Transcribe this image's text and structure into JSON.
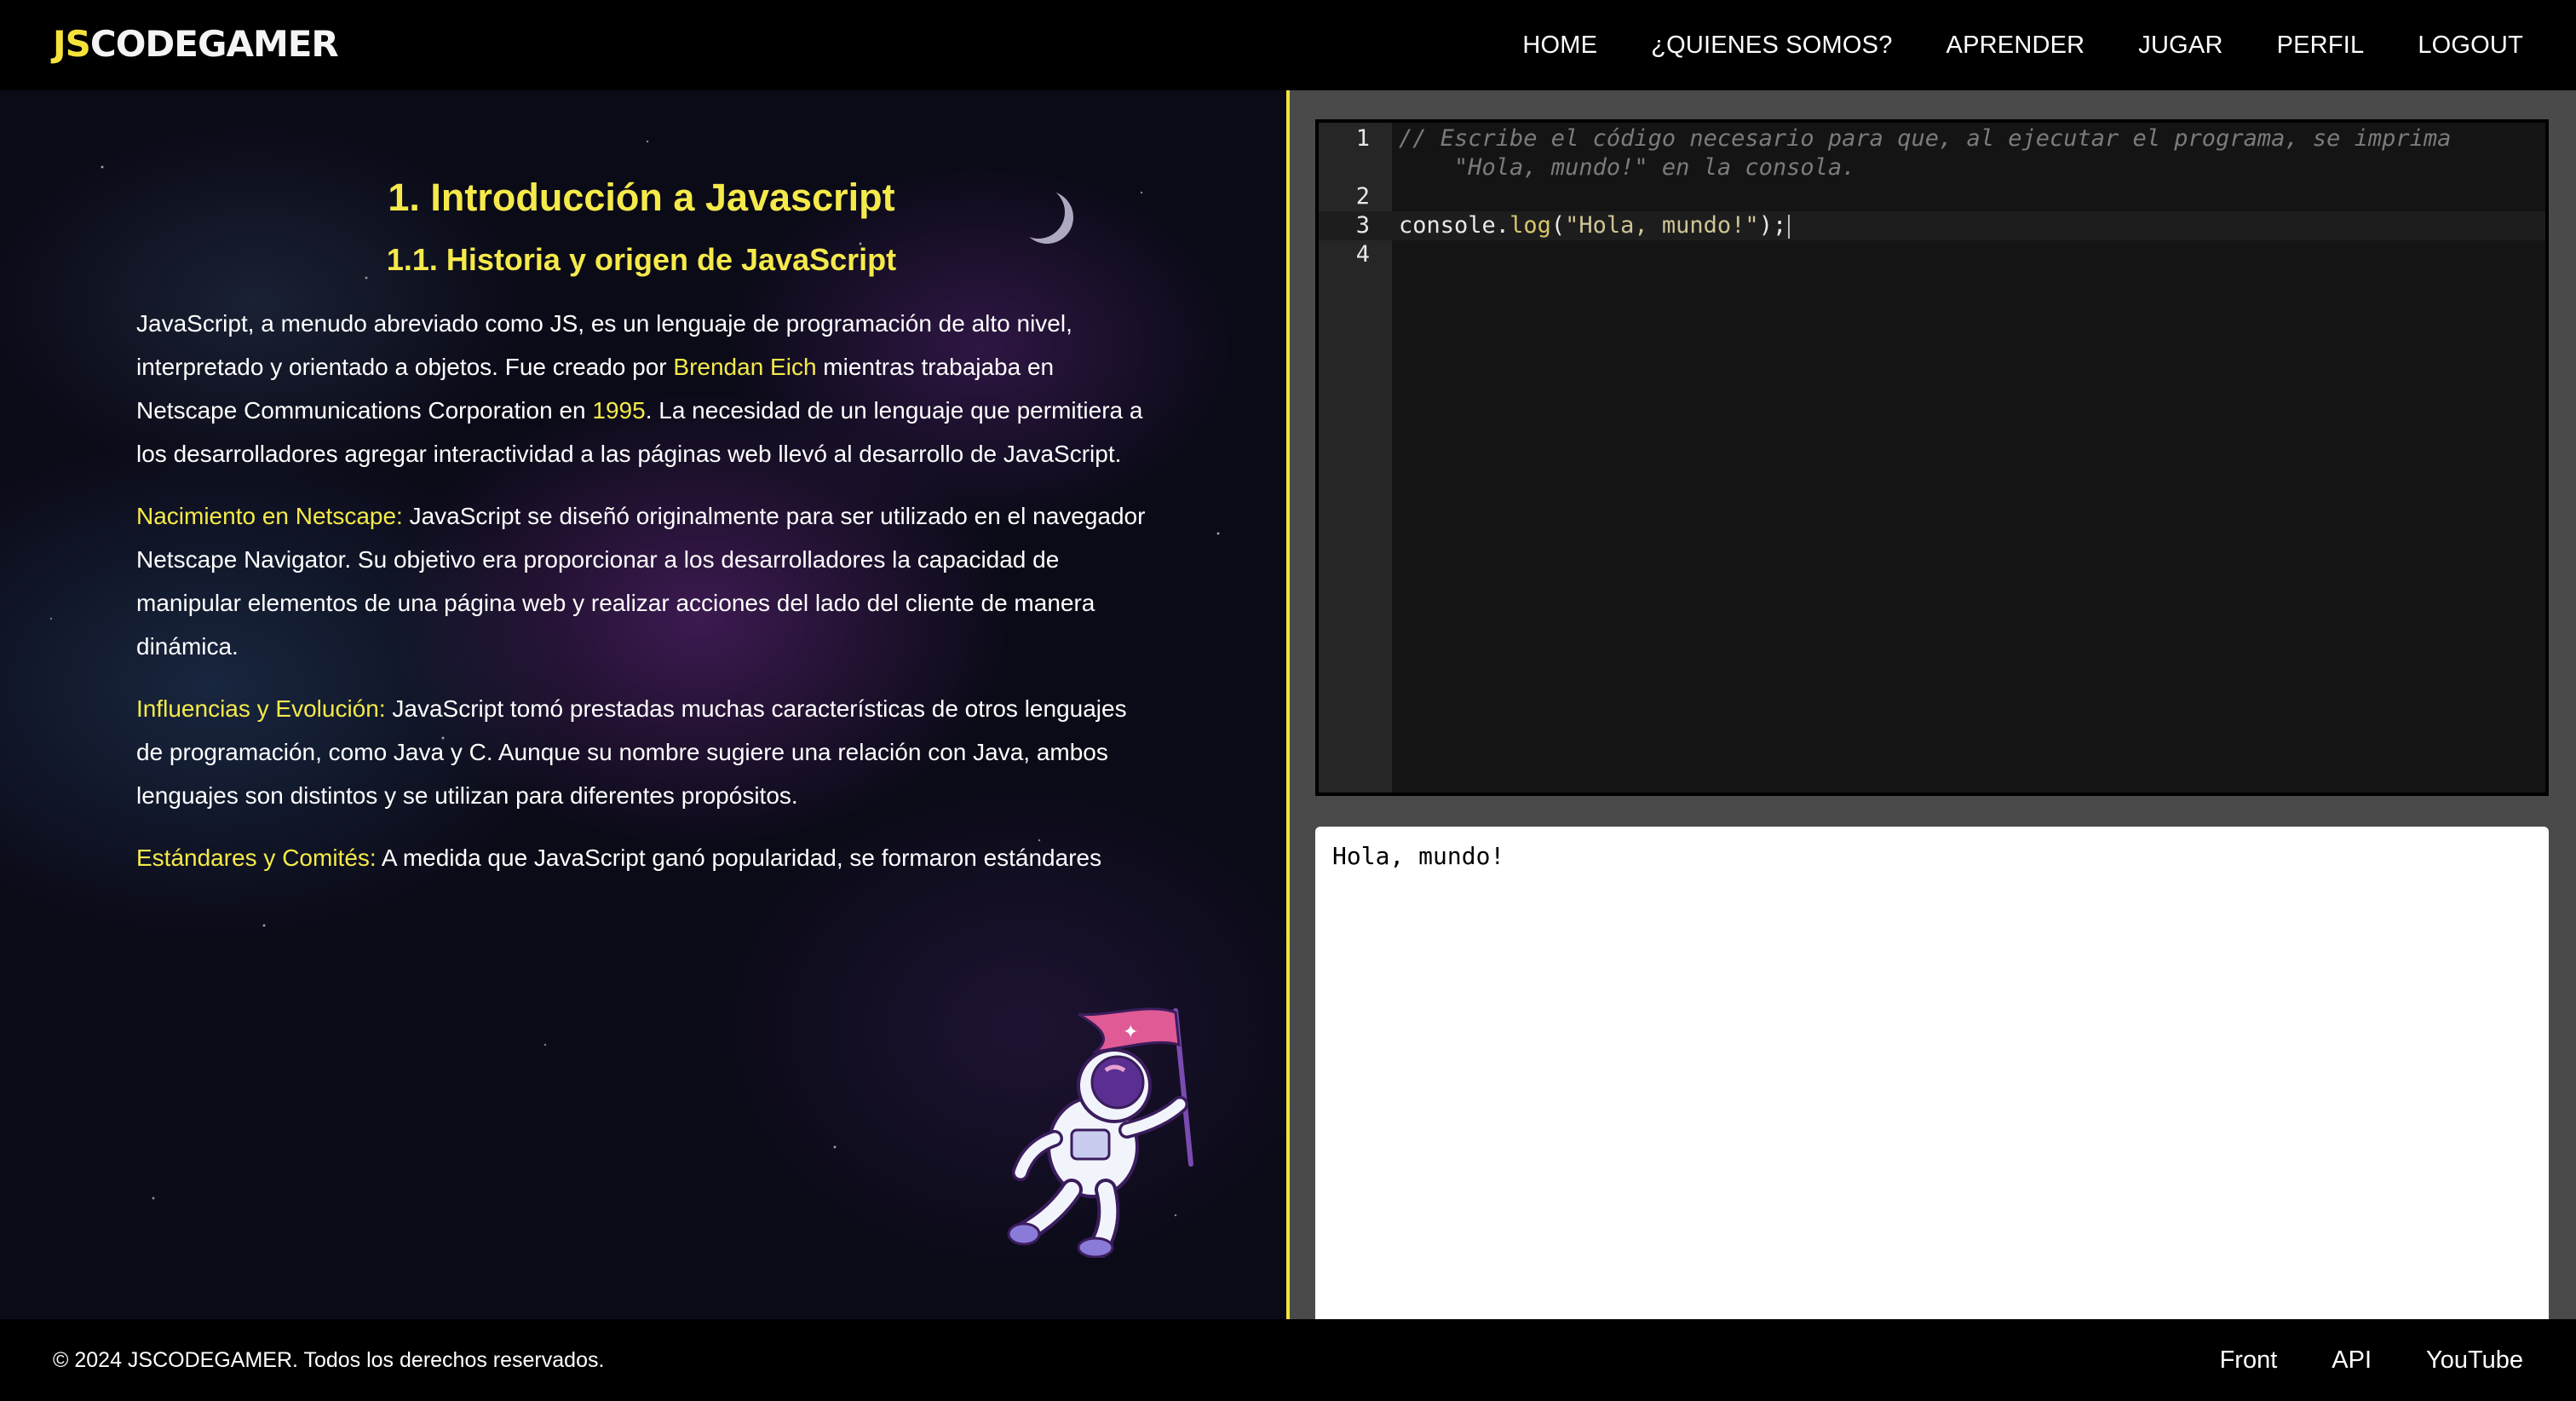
{
  "header": {
    "logo_js": "JS",
    "logo_rest": "CODEGAMER",
    "nav": [
      {
        "label": "HOME"
      },
      {
        "label": "¿QUIENES SOMOS?"
      },
      {
        "label": "APRENDER"
      },
      {
        "label": "JUGAR"
      },
      {
        "label": "PERFIL"
      },
      {
        "label": "LOGOUT"
      }
    ]
  },
  "lesson": {
    "title": "1. Introducción a Javascript",
    "subtitle": "1.1. Historia y origen de JavaScript",
    "p1": {
      "a": "JavaScript, a menudo abreviado como JS, es un lenguaje de programación de alto nivel, interpretado y orientado a objetos. Fue creado por ",
      "b": "Brendan Eich",
      "c": " mientras trabajaba en Netscape Communications Corporation en ",
      "d": "1995",
      "e": ". La necesidad de un lenguaje que permitiera a los desarrolladores agregar interactividad a las páginas web llevó al desarrollo de JavaScript."
    },
    "p2": {
      "label": "Nacimiento en Netscape:",
      "text": " JavaScript se diseñó originalmente para ser utilizado en el navegador Netscape Navigator. Su objetivo era proporcionar a los desarrolladores la capacidad de manipular elementos de una página web y realizar acciones del lado del cliente de manera dinámica."
    },
    "p3": {
      "label": "Influencias y Evolución:",
      "text": " JavaScript tomó prestadas muchas características de otros lenguajes de programación, como Java y C. Aunque su nombre sugiere una relación con Java, ambos lenguajes son distintos y se utilizan para diferentes propósitos."
    },
    "p4": {
      "label": "Estándares y Comités:",
      "text": " A medida que JavaScript ganó popularidad, se formaron estándares"
    }
  },
  "editor": {
    "line_numbers": [
      "1",
      "2",
      "3",
      "4"
    ],
    "comment_line1": "// Escribe el código necesario para que, al ejecutar el programa, se imprima",
    "comment_line2": "    \"Hola, mundo!\" en la consola.",
    "code_obj": "console",
    "code_dot": ".",
    "code_method": "log",
    "code_open": "(",
    "code_str": "\"Hola, mundo!\"",
    "code_close": ");"
  },
  "output": {
    "text": "Hola, mundo!"
  },
  "footer": {
    "copyright": "© 2024 JSCODEGAMER. Todos los derechos reservados.",
    "links": [
      {
        "label": "Front"
      },
      {
        "label": "API"
      },
      {
        "label": "YouTube"
      }
    ]
  },
  "colors": {
    "accent": "#f5e33b",
    "background": "#000000",
    "editor_bg": "#141414",
    "panel_bg": "#4a4a4a"
  }
}
